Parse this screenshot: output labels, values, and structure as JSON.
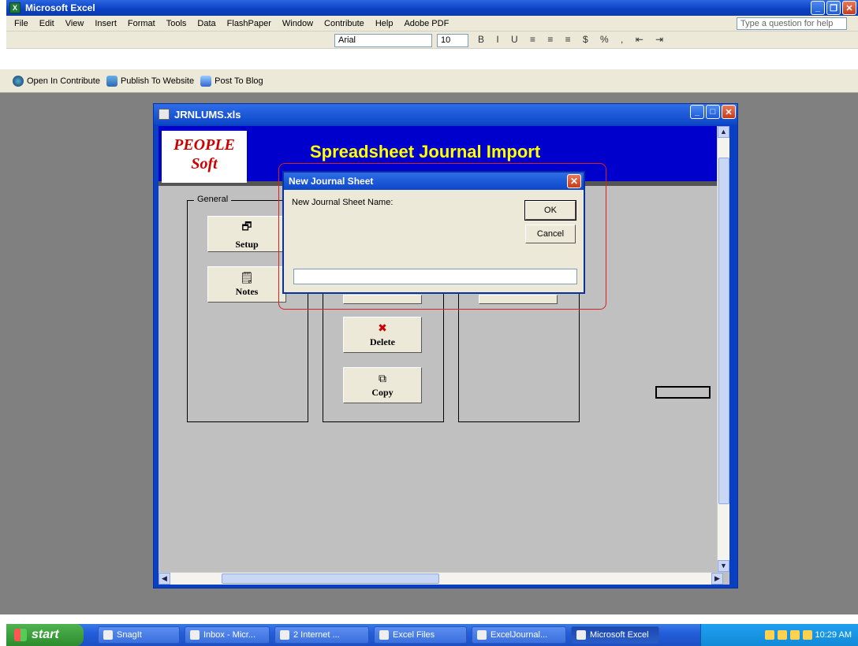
{
  "app": {
    "title": "Microsoft Excel",
    "menu": [
      "File",
      "Edit",
      "View",
      "Insert",
      "Format",
      "Tools",
      "Data",
      "FlashPaper",
      "Window",
      "Contribute",
      "Help",
      "Adobe PDF"
    ],
    "help_placeholder": "Type a question for help",
    "font_name": "Arial",
    "font_size": "10",
    "format_glyphs": "B I U ≡ ≡ ≡ $ % , ⇤ ⇥",
    "contribute": {
      "open": "Open In Contribute",
      "publish": "Publish To Website",
      "blog": "Post To Blog"
    }
  },
  "workbook": {
    "title": "JRNLUMS.xls",
    "logo": "PEOPLE Soft",
    "banner_title": "Spreadsheet Journal Import",
    "group_general": "General",
    "buttons": {
      "setup": "Setup",
      "notes": "Notes",
      "delete": "Delete",
      "copy": "Copy"
    }
  },
  "dialog": {
    "title": "New Journal Sheet",
    "label": "New Journal Sheet Name:",
    "ok": "OK",
    "cancel": "Cancel",
    "input_value": ""
  },
  "taskbar": {
    "start": "start",
    "tasks": [
      "SnagIt",
      "Inbox - Micr...",
      "2 Internet ...",
      "Excel Files",
      "ExcelJournal...",
      "Microsoft Excel"
    ],
    "clock": "10:29 AM"
  }
}
